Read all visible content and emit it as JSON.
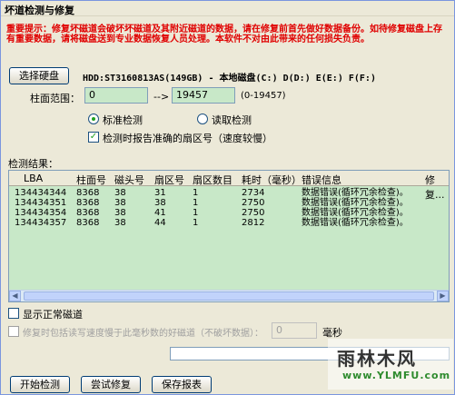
{
  "window": {
    "title": "坏道检测与修复"
  },
  "warning": "重要提示：修复坏磁道会破坏坏磁道及其附近磁道的数据，请在修复前首先做好数据备份。如待修复磁盘上存有重要数据，请将磁盘送到专业数据恢复人员处理。本软件不对由此带来的任何损失负责。",
  "select_disk": {
    "label": "选择硬盘",
    "info": "HDD:ST3160813AS(149GB) - 本地磁盘(C:) D(D:) E(E:) F(F:)"
  },
  "range": {
    "label": "柱面范围：",
    "start": "0",
    "arrow": "-->",
    "end": "19457",
    "hint": "(0-19457)"
  },
  "mode": {
    "standard": "标准检测",
    "read": "读取检测",
    "selected": "standard"
  },
  "report_option": {
    "label": "检测时报告准确的扇区号（速度较慢）",
    "checked": true
  },
  "results": {
    "label": "检测结果：",
    "columns": [
      "LBA",
      "柱面号",
      "磁头号",
      "扇区号",
      "扇区数目",
      "耗时（毫秒）",
      "错误信息",
      "修复..."
    ],
    "rows": [
      [
        "134434344",
        "8368",
        "38",
        "31",
        "1",
        "2734",
        "数据错误(循环冗余检查)。"
      ],
      [
        "134434351",
        "8368",
        "38",
        "38",
        "1",
        "2750",
        "数据错误(循环冗余检查)。"
      ],
      [
        "134434354",
        "8368",
        "38",
        "41",
        "1",
        "2750",
        "数据错误(循环冗余检查)。"
      ],
      [
        "134434357",
        "8368",
        "38",
        "44",
        "1",
        "2812",
        "数据错误(循环冗余检查)。"
      ]
    ]
  },
  "show_normal": {
    "label": "显示正常磁道",
    "checked": false
  },
  "repair_slow": {
    "label": "修复时包括读写速度慢于此毫秒数的好磁道（不破坏数据）：",
    "value": "0",
    "unit": "毫秒",
    "checked": false
  },
  "buttons": {
    "start": "开始检测",
    "repair": "尝试修复",
    "save": "保存报表"
  },
  "watermark": {
    "title": "雨林木风",
    "url": "www.YLMFU.com"
  },
  "colors": {
    "list_bg": "#c8e8c8",
    "warning": "#e00000",
    "title_bar": "#ece9d8"
  }
}
